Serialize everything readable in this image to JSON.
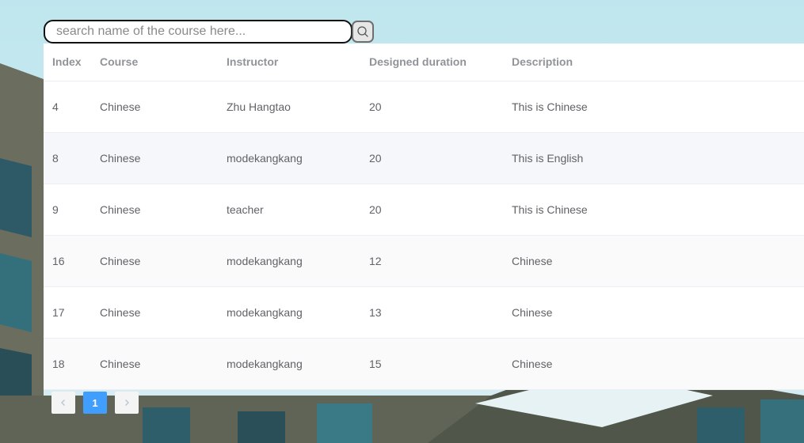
{
  "search": {
    "placeholder": "search name of the course here...",
    "button_icon": "search-icon"
  },
  "table": {
    "columns": [
      "Index",
      "Course",
      "Instructor",
      "Designed duration",
      "Description"
    ],
    "rows": [
      {
        "index": "4",
        "course": "Chinese",
        "instructor": "Zhu Hangtao",
        "duration": "20",
        "description": "This is Chinese"
      },
      {
        "index": "8",
        "course": "Chinese",
        "instructor": "modekangkang",
        "duration": "20",
        "description": "This is English"
      },
      {
        "index": "9",
        "course": "Chinese",
        "instructor": "teacher",
        "duration": "20",
        "description": "This is Chinese"
      },
      {
        "index": "16",
        "course": "Chinese",
        "instructor": "modekangkang",
        "duration": "12",
        "description": "Chinese"
      },
      {
        "index": "17",
        "course": "Chinese",
        "instructor": "modekangkang",
        "duration": "13",
        "description": "Chinese"
      },
      {
        "index": "18",
        "course": "Chinese",
        "instructor": "modekangkang",
        "duration": "15",
        "description": "Chinese"
      }
    ]
  },
  "pagination": {
    "prev_icon": "chevron-left-icon",
    "current_page": "1",
    "next_icon": "chevron-right-icon",
    "active_color": "#409eff"
  }
}
